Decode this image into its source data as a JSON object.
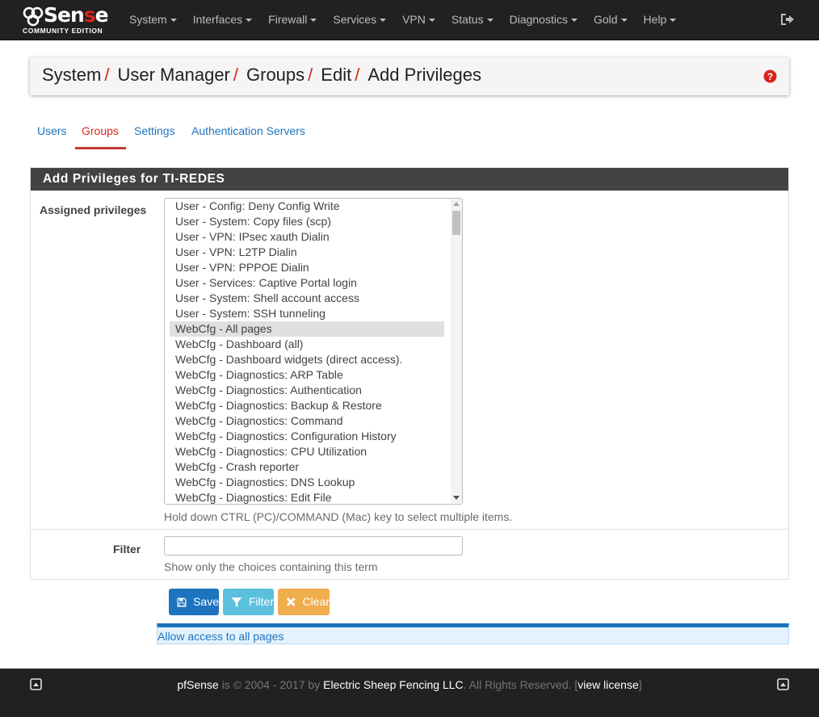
{
  "navbar": {
    "logo_word_start": "Sen",
    "logo_word_red": "s",
    "logo_word_end": "e",
    "logo_sub": "COMMUNITY EDITION",
    "menu": [
      "System",
      "Interfaces",
      "Firewall",
      "Services",
      "VPN",
      "Status",
      "Diagnostics",
      "Gold",
      "Help"
    ]
  },
  "breadcrumb": {
    "items": [
      "System",
      "User Manager",
      "Groups",
      "Edit",
      "Add Privileges"
    ],
    "separator": "/"
  },
  "tabs": {
    "items": [
      "Users",
      "Groups",
      "Settings",
      "Authentication Servers"
    ],
    "active": "Groups"
  },
  "panel": {
    "heading": "Add Privileges for TI-REDES",
    "assigned_label": "Assigned privileges",
    "privileges": [
      "User - Config: Deny Config Write",
      "User - System: Copy files (scp)",
      "User - VPN: IPsec xauth Dialin",
      "User - VPN: L2TP Dialin",
      "User - VPN: PPPOE Dialin",
      "User - Services: Captive Portal login",
      "User - System: Shell account access",
      "User - System: SSH tunneling",
      "WebCfg - All pages",
      "WebCfg - Dashboard (all)",
      "WebCfg - Dashboard widgets (direct access).",
      "WebCfg - Diagnostics: ARP Table",
      "WebCfg - Diagnostics: Authentication",
      "WebCfg - Diagnostics: Backup & Restore",
      "WebCfg - Diagnostics: Command",
      "WebCfg - Diagnostics: Configuration History",
      "WebCfg - Diagnostics: CPU Utilization",
      "WebCfg - Crash reporter",
      "WebCfg - Diagnostics: DNS Lookup",
      "WebCfg - Diagnostics: Edit File"
    ],
    "selected_privilege": "WebCfg - All pages",
    "privileges_help": "Hold down CTRL (PC)/COMMAND (Mac) key to select multiple items.",
    "filter_label": "Filter",
    "filter_value": "",
    "filter_help": "Show only the choices containing this term"
  },
  "buttons": {
    "save": "Save",
    "filter": "Filter",
    "clear": "Clear"
  },
  "info": {
    "text": "Allow access to all pages"
  },
  "footer": {
    "brand": "pfSense",
    "copyright": " is © 2004 - 2017 by ",
    "company": "Electric Sheep Fencing LLC",
    "rights": ". All Rights Reserved. [",
    "license": "view license",
    "close_bracket": "]"
  },
  "colors": {
    "navbar_bg": "#212121",
    "accent_red": "#d9231d",
    "link_blue": "#1e73be",
    "panel_heading": "#424242",
    "info_button": "#5bc0de",
    "warning_button": "#f0ad4e"
  },
  "icons": {
    "logout": "sign-out-icon",
    "help": "question-circle-icon",
    "save": "save-icon",
    "filter": "filter-icon",
    "clear": "close-icon",
    "footer_left": "caret-square-up-icon",
    "footer_right": "caret-square-up-icon"
  }
}
